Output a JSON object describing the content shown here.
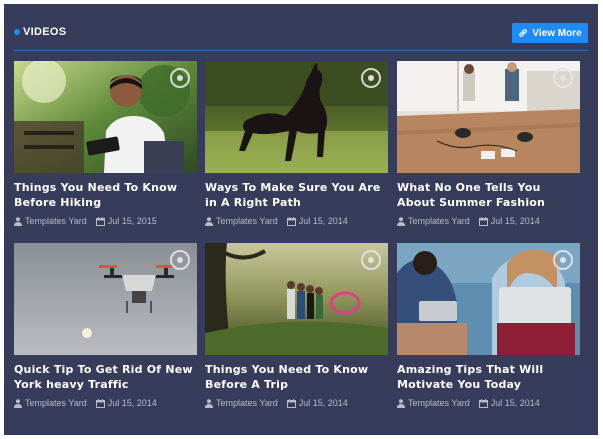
{
  "header": {
    "title": "VIDEOS",
    "view_more_label": "View More",
    "link_icon": "link-icon"
  },
  "colors": {
    "background": "#363c5a",
    "accent": "#1d8cf8",
    "divider": "#2d6ea6",
    "meta_text": "#b7bccd"
  },
  "cards": [
    {
      "title": "Things You Need To Know Before Hiking",
      "author": "Templates Yard",
      "date": "Jul 15, 2015",
      "image": "man-with-tablet-outdoors"
    },
    {
      "title": "Ways To Make Sure You Are in A Right Path",
      "author": "Templates Yard",
      "date": "Jul 15, 2014",
      "image": "rearing-black-horse"
    },
    {
      "title": "What No One Tells You About Summer Fashion",
      "author": "Templates Yard",
      "date": "Jul 15, 2014",
      "image": "office-meeting-table"
    },
    {
      "title": "Quick Tip To Get Rid Of New York heavy Traffic",
      "author": "Templates Yard",
      "date": "Jul 15, 2014",
      "image": "flying-drone"
    },
    {
      "title": "Things You Need To Know Before A Trip",
      "author": "Templates Yard",
      "date": "Jul 15, 2014",
      "image": "children-in-forest"
    },
    {
      "title": "Amazing Tips That Will Motivate You Today",
      "author": "Templates Yard",
      "date": "Jul 15, 2014",
      "image": "people-with-laptop"
    }
  ],
  "icons": {
    "author": "user-icon",
    "date": "calendar-icon",
    "play": "play-icon"
  }
}
